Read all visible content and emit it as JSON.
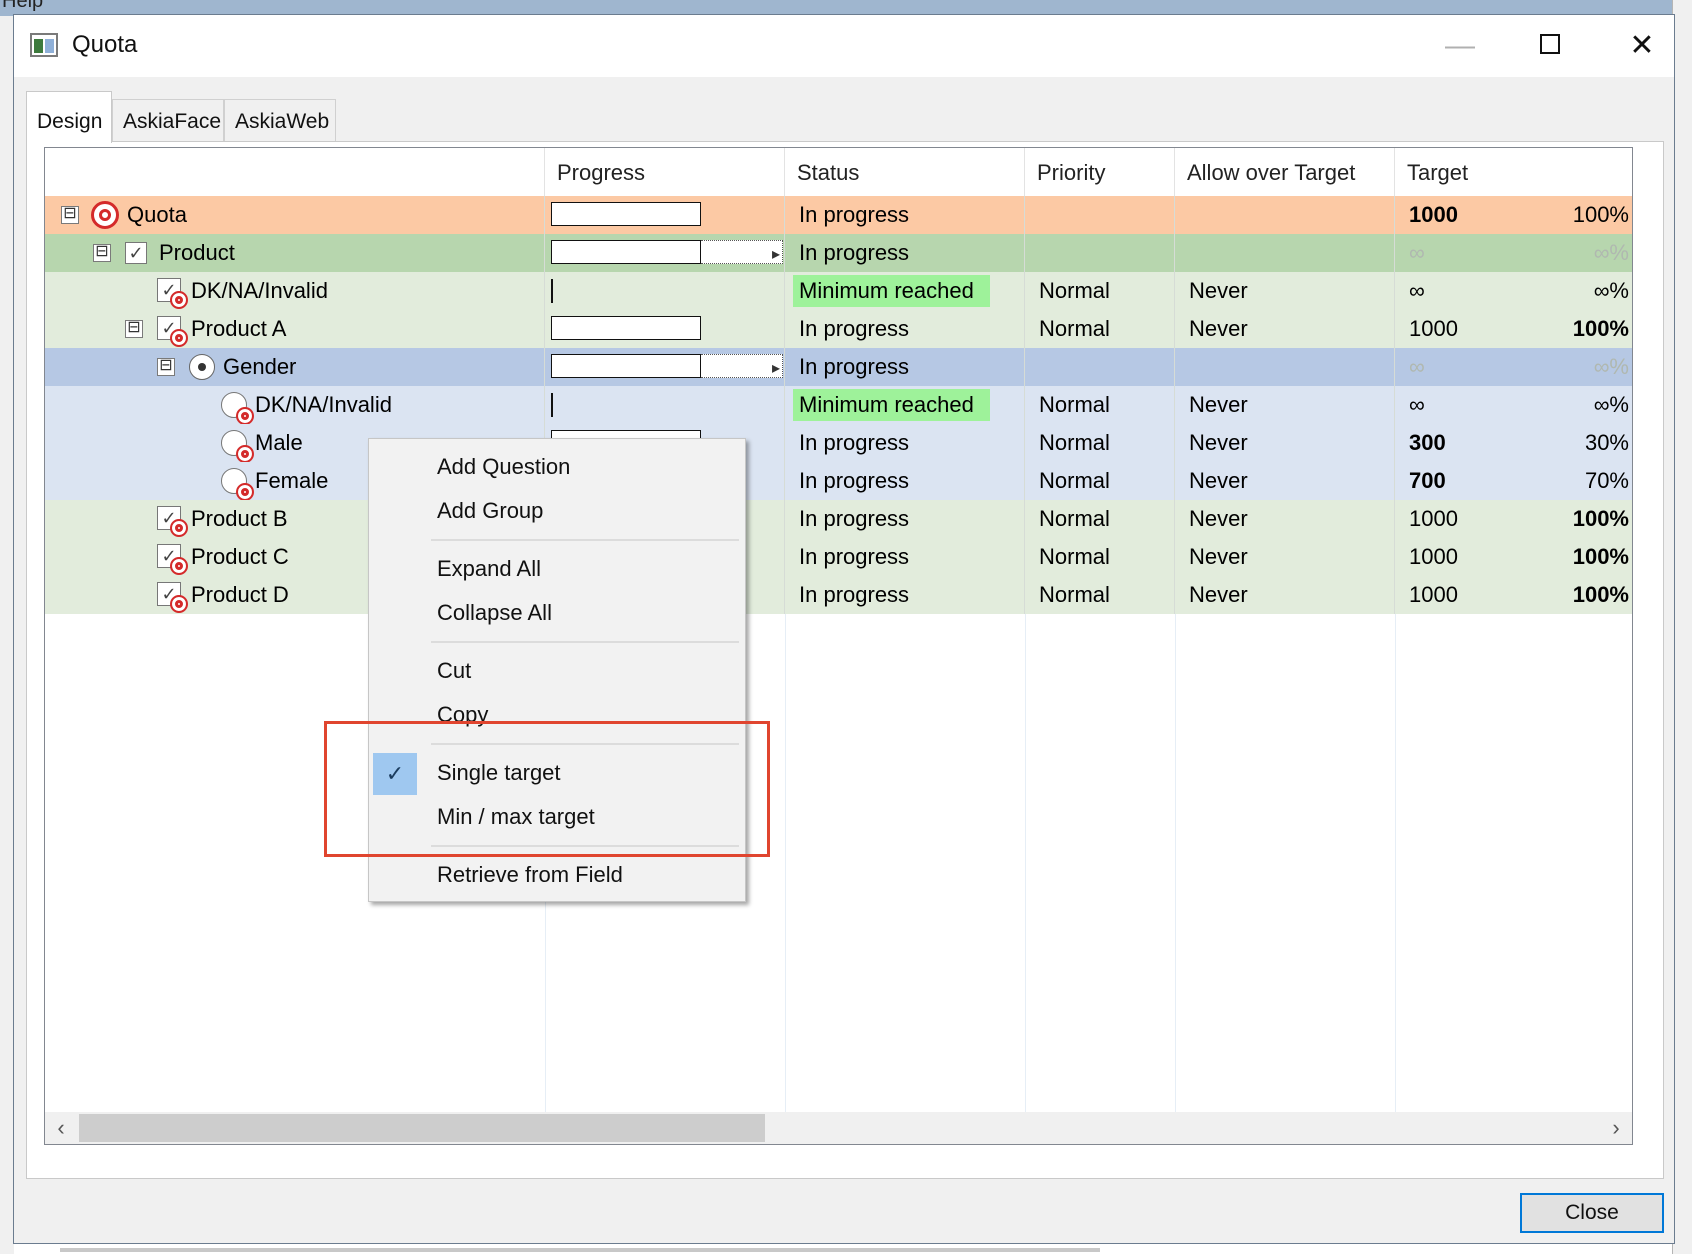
{
  "window": {
    "title": "Quota",
    "close_button": "Close",
    "partial_menu_text": "Help"
  },
  "tabs": [
    {
      "label": "Design",
      "active": true
    },
    {
      "label": "AskiaFace"
    },
    {
      "label": "AskiaWeb"
    }
  ],
  "columns": [
    "",
    "Progress",
    "Status",
    "Priority",
    "Allow over Target",
    "Target"
  ],
  "rows": [
    {
      "name": "Quota",
      "status": "In progress",
      "priority": "",
      "allow": "",
      "target": "1000",
      "pct": "100%"
    },
    {
      "name": "Product",
      "status": "In progress",
      "priority": "",
      "allow": "",
      "target": "∞",
      "pct": "∞%"
    },
    {
      "name": "DK/NA/Invalid",
      "status": "Minimum reached",
      "priority": "Normal",
      "allow": "Never",
      "target": "∞",
      "pct": "∞%"
    },
    {
      "name": "Product A",
      "status": "In progress",
      "priority": "Normal",
      "allow": "Never",
      "target": "1000",
      "pct": "100%"
    },
    {
      "name": "Gender",
      "status": "In progress",
      "priority": "",
      "allow": "",
      "target": "∞",
      "pct": "∞%"
    },
    {
      "name": "DK/NA/Invalid",
      "status": "Minimum reached",
      "priority": "Normal",
      "allow": "Never",
      "target": "∞",
      "pct": "∞%"
    },
    {
      "name": "Male",
      "status": "In progress",
      "priority": "Normal",
      "allow": "Never",
      "target": "300",
      "pct": "30%"
    },
    {
      "name": "Female",
      "status": "In progress",
      "priority": "Normal",
      "allow": "Never",
      "target": "700",
      "pct": "70%"
    },
    {
      "name": "Product B",
      "status": "In progress",
      "priority": "Normal",
      "allow": "Never",
      "target": "1000",
      "pct": "100%"
    },
    {
      "name": "Product C",
      "status": "In progress",
      "priority": "Normal",
      "allow": "Never",
      "target": "1000",
      "pct": "100%"
    },
    {
      "name": "Product D",
      "status": "In progress",
      "priority": "Normal",
      "allow": "Never",
      "target": "1000",
      "pct": "100%"
    }
  ],
  "context_menu": {
    "add_question": "Add Question",
    "add_group": "Add Group",
    "expand_all": "Expand All",
    "collapse_all": "Collapse All",
    "cut": "Cut",
    "copy": "Copy",
    "single_target": "Single target",
    "min_max_target": "Min / max target",
    "retrieve_from_field": "Retrieve from Field"
  },
  "glyphs": {
    "expander": "⊟",
    "check": "✓",
    "left_arrow": "‹",
    "right_arrow": "›",
    "close_x": "✕",
    "minimize": "—"
  },
  "colors": {
    "quota_row": "#fcc9a4",
    "product_row": "#b7d6ae",
    "product_child_row": "#e2ecdc",
    "gender_row": "#b6c8e4",
    "gender_child_row": "#dbe4f2",
    "minimum_reached": "#9ef29a",
    "highlight": "#e0452f"
  }
}
